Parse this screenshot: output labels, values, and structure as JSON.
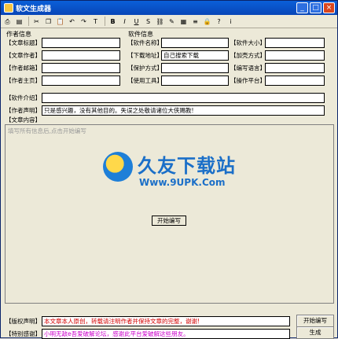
{
  "window": {
    "title": "软文生成器"
  },
  "toolbar": {
    "tools": [
      {
        "name": "print-icon",
        "glyph": "⎙"
      },
      {
        "name": "preview-icon",
        "glyph": "▤"
      },
      {
        "name": "cut-icon",
        "glyph": "✂"
      },
      {
        "name": "copy-icon",
        "glyph": "❐"
      },
      {
        "name": "paste-icon",
        "glyph": "📋"
      },
      {
        "name": "undo-icon",
        "glyph": "↶"
      },
      {
        "name": "redo-icon",
        "glyph": "↷"
      },
      {
        "name": "format-icon",
        "glyph": "T"
      },
      {
        "name": "bold-icon",
        "glyph": "B"
      },
      {
        "name": "italic-icon",
        "glyph": "I"
      },
      {
        "name": "underline-icon",
        "glyph": "U"
      },
      {
        "name": "strike-icon",
        "glyph": "S"
      },
      {
        "name": "link-icon",
        "glyph": "⛓"
      },
      {
        "name": "color-icon",
        "glyph": "✎"
      },
      {
        "name": "highlight-icon",
        "glyph": "▦"
      },
      {
        "name": "align-icon",
        "glyph": "≡"
      },
      {
        "name": "lock-icon",
        "glyph": "🔒"
      },
      {
        "name": "help-icon",
        "glyph": "?"
      },
      {
        "name": "info-icon",
        "glyph": "i"
      }
    ]
  },
  "author": {
    "group_label": "作者信息",
    "fields": [
      {
        "label": "【文章标题】",
        "value": ""
      },
      {
        "label": "【文章作者】",
        "value": ""
      },
      {
        "label": "【作者邮箱】",
        "value": ""
      },
      {
        "label": "【作者主页】",
        "value": ""
      }
    ]
  },
  "software": {
    "group_label": "软件信息",
    "left": [
      {
        "label": "【软件名称】",
        "value": ""
      },
      {
        "label": "【下载地址】",
        "value": "自己搜索下载"
      },
      {
        "label": "【保护方式】",
        "value": ""
      },
      {
        "label": "【使用工具】",
        "value": ""
      }
    ],
    "right": [
      {
        "label": "【软件大小】",
        "value": ""
      },
      {
        "label": "【加壳方式】",
        "value": ""
      },
      {
        "label": "【编写语言】",
        "value": ""
      },
      {
        "label": "【操作平台】",
        "value": ""
      }
    ]
  },
  "intro": {
    "label": "【软件介绍】",
    "value": ""
  },
  "statement": {
    "label": "【作者声明】",
    "value": "只是感兴趣，没有其他目的。失误之处敬请诸位大侠赐教!"
  },
  "content": {
    "label": "【文章内容】",
    "hint": "填写所有信息后,点击开始编写",
    "start_button": "开始编写"
  },
  "watermark": {
    "title": "久友下载站",
    "url": "Www.9UPK.Com"
  },
  "footer": {
    "copyright_label": "【版权声明】",
    "copyright_value": "本文章本人原创，转载请注明作者并保持文章的完整，谢谢!",
    "thanks_label": "【特别感谢】",
    "thanks_value": "小明无敌e吾爱破解论坛，感谢此平台爱破解这些朋友。",
    "start_button": "开始编写",
    "generate_button": "生成"
  }
}
